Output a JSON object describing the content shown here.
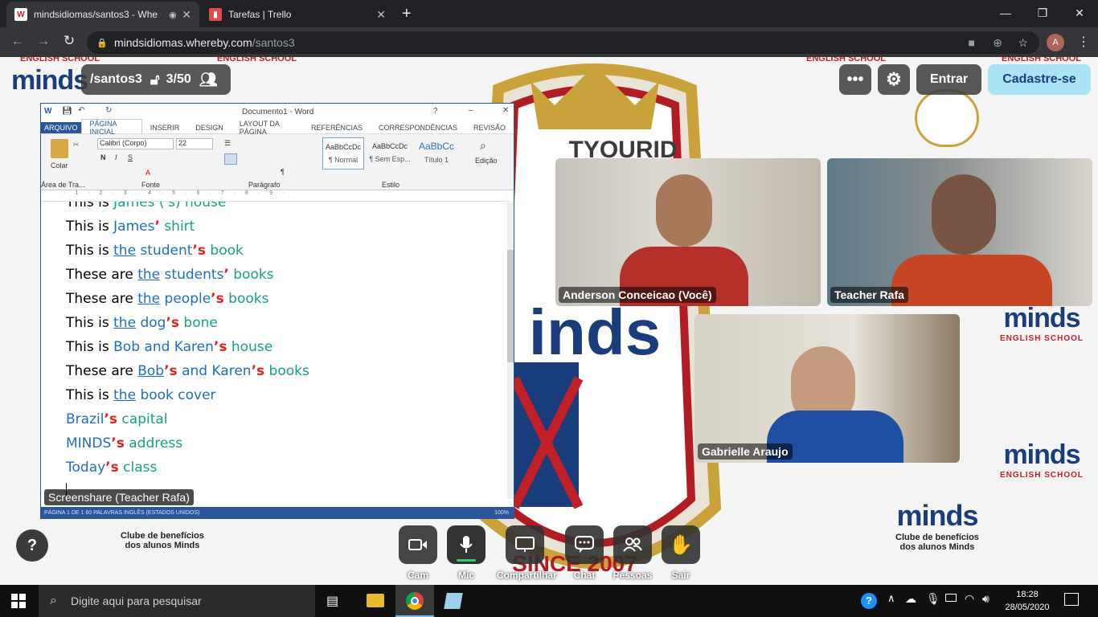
{
  "browser": {
    "tabs": [
      {
        "title": "mindsidiomas/santos3 - Whe",
        "active": true
      },
      {
        "title": "Tarefas | Trello",
        "active": false
      }
    ],
    "url_host": "mindsidiomas.whereby.com",
    "url_path": "/santos3",
    "profile_initial": "A"
  },
  "room": {
    "name": "/santos3",
    "count": "3/50"
  },
  "top_buttons": {
    "entrar": "Entrar",
    "cadastre": "Cadastre-se"
  },
  "watermark": {
    "school": "ENGLISH SCHOOL",
    "logo": "minds",
    "club_line1": "Clube de benefícios",
    "club_line2": "dos alunos Minds",
    "youid": "TYOURID",
    "since": "SINCE 2007"
  },
  "videos": [
    {
      "name": "Anderson Conceicao (Você)"
    },
    {
      "name": "Teacher Rafa"
    },
    {
      "name": "Gabrielle Araujo"
    }
  ],
  "screenshare_label": "Screenshare (Teacher Rafa)",
  "word": {
    "title": "Documento1 - Word",
    "tabs": [
      "ARQUIVO",
      "PÁGINA INICIAL",
      "INSERIR",
      "DESIGN",
      "LAYOUT DA PÁGINA",
      "REFERÊNCIAS",
      "CORRESPONDÊNCIAS",
      "REVISÃO"
    ],
    "font": "Calibri (Corpo)",
    "size": "22",
    "groups": [
      "Área de Tra...",
      "Fonte",
      "Parágrafo",
      "Estilo",
      "Edição"
    ],
    "paste": "Colar",
    "styles": [
      {
        "preview": "AaBbCcDc",
        "name": "¶ Normal"
      },
      {
        "preview": "AaBbCcDc",
        "name": "¶ Sem Esp..."
      },
      {
        "preview": "AaBbCc",
        "name": "Título 1"
      }
    ],
    "status": "PÁGINA 1 DE 1    60 PALAVRAS    INGLÊS (ESTADOS UNIDOS)",
    "zoom": "100%",
    "lines": [
      [
        [
          "This is ",
          "k"
        ],
        [
          "James ('s) house",
          "g"
        ]
      ],
      [
        [
          "This is ",
          "k"
        ],
        [
          "James",
          "b"
        ],
        [
          "’",
          "r"
        ],
        [
          " shirt",
          "g"
        ]
      ],
      [
        [
          "This is ",
          "k"
        ],
        [
          "the",
          "bu"
        ],
        [
          " student",
          "b"
        ],
        [
          "’s",
          "r"
        ],
        [
          " book",
          "g"
        ]
      ],
      [
        [
          "These are ",
          "k"
        ],
        [
          "the",
          "bu"
        ],
        [
          " students",
          "b"
        ],
        [
          "’",
          "r"
        ],
        [
          " books",
          "g"
        ]
      ],
      [
        [
          "These are ",
          "k"
        ],
        [
          "the",
          "bu"
        ],
        [
          " people",
          "b"
        ],
        [
          "’s",
          "r"
        ],
        [
          " books",
          "g"
        ]
      ],
      [
        [
          "This is ",
          "k"
        ],
        [
          "the",
          "bu"
        ],
        [
          " dog",
          "b"
        ],
        [
          "’s",
          "r"
        ],
        [
          " bone",
          "g"
        ]
      ],
      [
        [
          "This is ",
          "k"
        ],
        [
          "Bob and Karen",
          "b"
        ],
        [
          "’s",
          "r"
        ],
        [
          " house",
          "g"
        ]
      ],
      [
        [
          "These are ",
          "k"
        ],
        [
          "Bob",
          "bu"
        ],
        [
          "’s",
          "r"
        ],
        [
          " and Karen",
          "b"
        ],
        [
          "’s",
          "r"
        ],
        [
          " books",
          "g"
        ]
      ],
      [
        [
          "This is ",
          "k"
        ],
        [
          "the",
          "bu"
        ],
        [
          " book cover",
          "b"
        ]
      ],
      [
        [
          "Brazil",
          "b"
        ],
        [
          "’s",
          "r"
        ],
        [
          " capital",
          "g"
        ]
      ],
      [
        [
          "MINDS",
          "b"
        ],
        [
          "’s",
          "r"
        ],
        [
          " address",
          "g"
        ]
      ],
      [
        [
          "Today",
          "b"
        ],
        [
          "’s",
          "r"
        ],
        [
          " class",
          "g"
        ]
      ]
    ]
  },
  "controls": [
    {
      "label": "Cam",
      "icon": "camera-icon"
    },
    {
      "label": "Mic",
      "icon": "mic-icon"
    },
    {
      "label": "Compartilhar",
      "icon": "screen-share-icon"
    },
    {
      "label": "Chat",
      "icon": "chat-icon"
    },
    {
      "label": "Pessoas",
      "icon": "people-icon"
    },
    {
      "label": "Sair",
      "icon": "leave-icon"
    }
  ],
  "help": "?",
  "taskbar": {
    "search": "Digite aqui para pesquisar",
    "time": "18:28",
    "date": "28/05/2020"
  },
  "colors": {
    "accent": "#1a3d7c",
    "red": "#c12026",
    "word_blue": "#2b579a",
    "cadastre": "#a9e3f5"
  }
}
